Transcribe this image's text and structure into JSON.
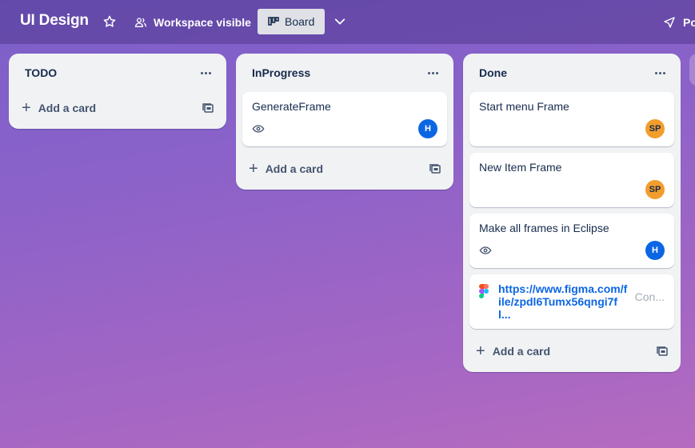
{
  "header": {
    "board_title": "UI Design",
    "visibility_label": "Workspace visible",
    "view_label": "Board",
    "power_label": "Po"
  },
  "lists": [
    {
      "title": "TODO",
      "cards": [],
      "add_label": "Add a card"
    },
    {
      "title": "InProgress",
      "cards": [
        {
          "title": "GenerateFrame",
          "watched": true,
          "member_initials": "H",
          "member_color": "#0c66e4"
        }
      ],
      "add_label": "Add a card"
    },
    {
      "title": "Done",
      "cards": [
        {
          "title": "Start menu Frame",
          "member_initials": "SP",
          "member_color": "#f29d2c"
        },
        {
          "title": "New Item Frame",
          "member_initials": "SP",
          "member_color": "#f29d2c"
        },
        {
          "title": "Make all frames in Eclipse",
          "watched": true,
          "member_initials": "H",
          "member_color": "#0c66e4"
        },
        {
          "link": "https://www.figma.com/file/zpdl6Tumx56qngi7fl...",
          "status": "Con..."
        }
      ],
      "add_label": "Add a card"
    }
  ],
  "icons": {
    "star": "star-icon",
    "visibility": "workspace-visible-icon",
    "board": "board-view-icon",
    "views": "chevron-down-icon",
    "power": "power-ups-icon",
    "menu": "ellipsis-icon",
    "watch": "eye-icon",
    "template": "create-from-template-icon",
    "figma": "figma-logo-icon"
  }
}
